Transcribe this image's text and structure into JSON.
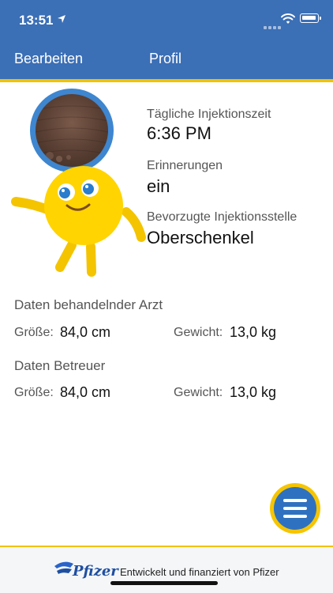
{
  "status_bar": {
    "time": "13:51",
    "location_icon": "location-arrow-icon",
    "wifi_icon": "wifi-icon",
    "battery_icon": "battery-icon"
  },
  "nav": {
    "left_button": "Bearbeiten",
    "title": "Profil"
  },
  "profile": {
    "daily_injection_time_label": "Tägliche Injektionszeit",
    "daily_injection_time_value": "6:36 PM",
    "reminders_label": "Erinnerungen",
    "reminders_value": "ein",
    "preferred_site_label": "Bevorzugte Injektionsstelle",
    "preferred_site_value": "Oberschenkel"
  },
  "doctor_section": {
    "title": "Daten behandelnder Arzt",
    "height_label": "Größe:",
    "height_value": "84,0 cm",
    "weight_label": "Gewicht:",
    "weight_value": "13,0 kg"
  },
  "caregiver_section": {
    "title": "Daten Betreuer",
    "height_label": "Größe:",
    "height_value": "84,0 cm",
    "weight_label": "Gewicht:",
    "weight_value": "13,0 kg"
  },
  "fab": {
    "icon": "menu-icon"
  },
  "footer": {
    "brand": "Pfizer",
    "text": "Entwickelt und finanziert von Pfizer"
  },
  "colors": {
    "header_blue": "#3b6fb6",
    "accent_yellow": "#f2c200",
    "fab_blue": "#2e71c0"
  }
}
